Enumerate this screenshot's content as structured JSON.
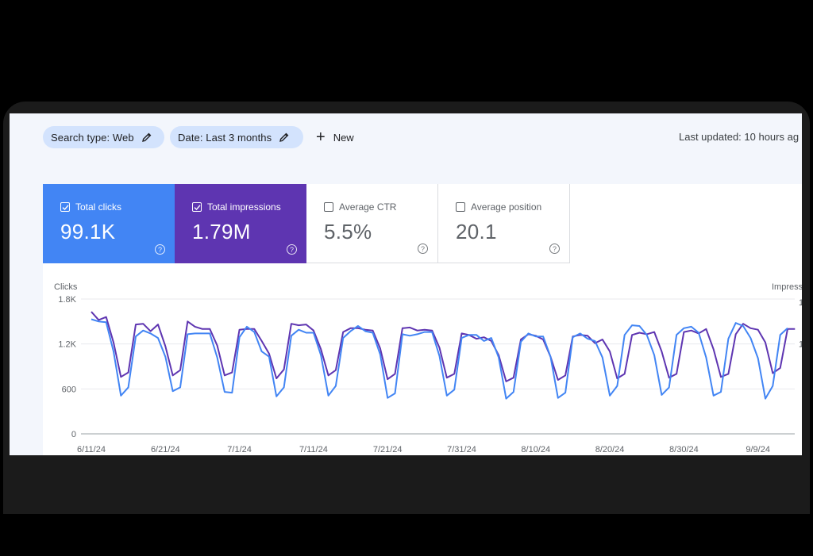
{
  "filters": {
    "search_type_label": "Search type: Web",
    "date_label": "Date: Last 3 months",
    "new_label": "New",
    "last_updated": "Last updated: 10 hours ag"
  },
  "metrics": [
    {
      "label": "Total clicks",
      "value": "99.1K",
      "checked": true
    },
    {
      "label": "Total impressions",
      "value": "1.79M",
      "checked": true
    },
    {
      "label": "Average CTR",
      "value": "5.5%",
      "checked": false
    },
    {
      "label": "Average position",
      "value": "20.1",
      "checked": false
    }
  ],
  "colors": {
    "clicks": "#4285f4",
    "impressions": "#5e35b1"
  },
  "icons": [
    "pencil-icon",
    "plus-icon",
    "checkbox-icon",
    "help-icon"
  ],
  "chart_data": {
    "type": "line",
    "ylabel_left": "Clicks",
    "ylabel_right": "Impress",
    "ylim": [
      0,
      1800
    ],
    "yticks": [
      "0",
      "600",
      "1.2K",
      "1.8K"
    ],
    "ytick_values": [
      0,
      600,
      1200,
      1800
    ],
    "right_ticks": [
      "1",
      "1"
    ],
    "xticks": [
      "6/11/24",
      "6/21/24",
      "7/1/24",
      "7/11/24",
      "7/21/24",
      "7/31/24",
      "8/10/24",
      "8/20/24",
      "8/30/24",
      "9/9/24"
    ],
    "x_start": "6/11/24",
    "grid": true,
    "series": [
      {
        "name": "Clicks",
        "color": "#4285f4",
        "values": [
          1530,
          1500,
          1490,
          1100,
          510,
          620,
          1300,
          1380,
          1340,
          1280,
          1030,
          570,
          620,
          1330,
          1340,
          1340,
          1340,
          1020,
          560,
          550,
          1290,
          1430,
          1360,
          1100,
          1030,
          500,
          620,
          1310,
          1390,
          1350,
          1350,
          1050,
          510,
          640,
          1280,
          1370,
          1440,
          1370,
          1350,
          1060,
          480,
          540,
          1330,
          1310,
          1330,
          1360,
          1360,
          1040,
          510,
          590,
          1280,
          1320,
          1320,
          1240,
          1280,
          1020,
          470,
          560,
          1230,
          1340,
          1300,
          1300,
          1030,
          480,
          550,
          1290,
          1340,
          1270,
          1240,
          1020,
          510,
          640,
          1320,
          1450,
          1440,
          1320,
          1050,
          520,
          620,
          1320,
          1410,
          1430,
          1350,
          1020,
          510,
          560,
          1270,
          1480,
          1440,
          1280,
          1010,
          470,
          640,
          1320,
          1410
        ]
      },
      {
        "name": "Impressions",
        "color": "#5e35b1",
        "values": [
          1630,
          1520,
          1560,
          1220,
          760,
          820,
          1460,
          1470,
          1370,
          1460,
          1170,
          780,
          850,
          1500,
          1430,
          1400,
          1400,
          1180,
          780,
          820,
          1390,
          1400,
          1400,
          1240,
          1070,
          740,
          860,
          1470,
          1450,
          1460,
          1380,
          1130,
          780,
          850,
          1360,
          1410,
          1410,
          1390,
          1380,
          1140,
          730,
          800,
          1410,
          1420,
          1380,
          1390,
          1380,
          1150,
          750,
          800,
          1340,
          1320,
          1270,
          1290,
          1240,
          1050,
          700,
          750,
          1260,
          1330,
          1310,
          1260,
          1030,
          720,
          780,
          1300,
          1320,
          1310,
          1210,
          1260,
          1100,
          740,
          800,
          1320,
          1350,
          1330,
          1360,
          1100,
          750,
          800,
          1360,
          1380,
          1340,
          1400,
          1130,
          760,
          800,
          1330,
          1470,
          1410,
          1390,
          1220,
          810,
          880,
          1400,
          1400
        ]
      }
    ]
  }
}
